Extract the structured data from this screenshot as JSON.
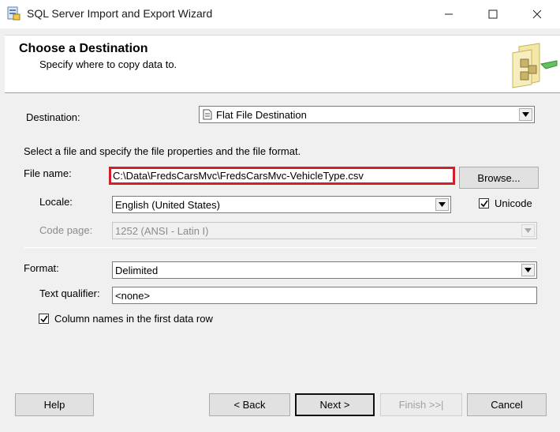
{
  "window": {
    "title": "SQL Server Import and Export Wizard"
  },
  "header": {
    "title": "Choose a Destination",
    "subtitle": "Specify where to copy data to."
  },
  "destination": {
    "label": "Destination:",
    "value": "Flat File Destination"
  },
  "instruction": "Select a file and specify the file properties and the file format.",
  "file_name": {
    "label": "File name:",
    "value": "C:\\Data\\FredsCarsMvc\\FredsCarsMvc-VehicleType.csv",
    "browse_label": "Browse..."
  },
  "locale": {
    "label": "Locale:",
    "value": "English (United States)"
  },
  "unicode": {
    "label": "Unicode",
    "checked": true
  },
  "code_page": {
    "label": "Code page:",
    "value": "1252  (ANSI - Latin I)"
  },
  "format": {
    "label": "Format:",
    "value": "Delimited"
  },
  "text_qualifier": {
    "label": "Text qualifier:",
    "value": "<none>"
  },
  "column_names": {
    "label": "Column names in the first data row",
    "checked": true
  },
  "footer": {
    "help": "Help",
    "back": "< Back",
    "next": "Next >",
    "finish": "Finish >>|",
    "cancel": "Cancel"
  }
}
